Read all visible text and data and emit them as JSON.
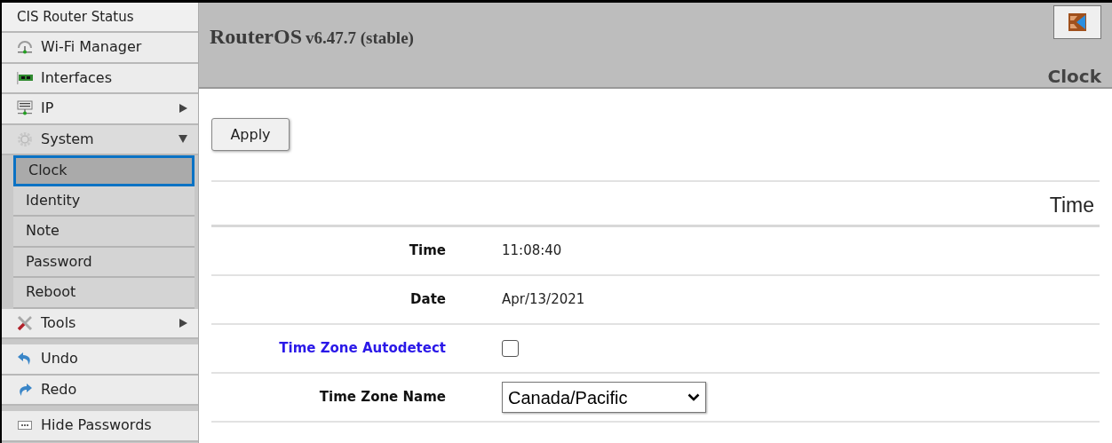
{
  "sidebar": {
    "title": "CIS Router Status",
    "groups": [
      [
        {
          "label": "Wi-Fi Manager",
          "submenu": false,
          "expanded": false
        },
        {
          "label": "Interfaces",
          "submenu": false,
          "expanded": false
        },
        {
          "label": "IP",
          "submenu": true,
          "expanded": false
        },
        {
          "label": "System",
          "submenu": true,
          "expanded": true,
          "children": [
            {
              "label": "Clock",
              "selected": true
            },
            {
              "label": "Identity",
              "selected": false
            },
            {
              "label": "Note",
              "selected": false
            },
            {
              "label": "Password",
              "selected": false
            },
            {
              "label": "Reboot",
              "selected": false
            }
          ]
        },
        {
          "label": "Tools",
          "submenu": true,
          "expanded": false
        }
      ],
      [
        {
          "label": "Undo",
          "submenu": false,
          "expanded": false
        },
        {
          "label": "Redo",
          "submenu": false,
          "expanded": false
        }
      ],
      [
        {
          "label": "Hide Passwords",
          "submenu": false,
          "expanded": false
        }
      ]
    ]
  },
  "header": {
    "product": "RouterOS",
    "version": "v6.47.7 (stable)",
    "page": "Clock"
  },
  "apply_button": "Apply",
  "section": {
    "title": "Time",
    "fields": [
      {
        "kind": "text",
        "label": "Time",
        "value": "11:08:40",
        "link": false
      },
      {
        "kind": "text",
        "label": "Date",
        "value": "Apr/13/2021",
        "link": false
      },
      {
        "kind": "checkbox",
        "label": "Time Zone Autodetect",
        "checked": false,
        "link": true
      },
      {
        "kind": "select",
        "label": "Time Zone Name",
        "value": "Canada/Pacific",
        "link": false
      }
    ]
  }
}
